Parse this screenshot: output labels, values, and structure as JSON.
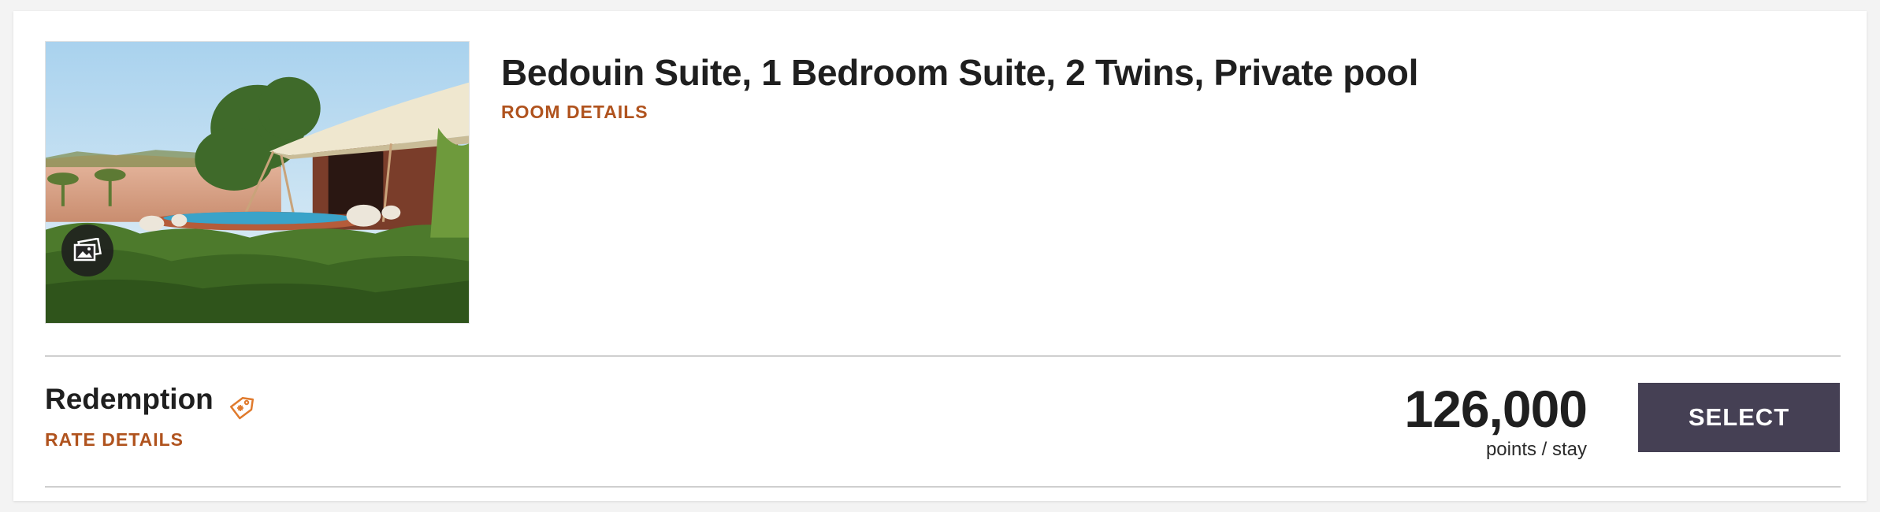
{
  "room": {
    "title": "Bedouin Suite, 1 Bedroom Suite, 2 Twins, Private pool",
    "details_link": "ROOM DETAILS",
    "image": {
      "icon": "gallery-icon"
    }
  },
  "rate": {
    "name": "Redemption",
    "details_link": "RATE DETAILS",
    "tag_icon": "tag-icon",
    "price": "126,000",
    "price_unit": "points / stay",
    "select_label": "SELECT"
  },
  "colors": {
    "link": "#b0531e",
    "button": "#454054",
    "tag": "#e07a2c"
  }
}
